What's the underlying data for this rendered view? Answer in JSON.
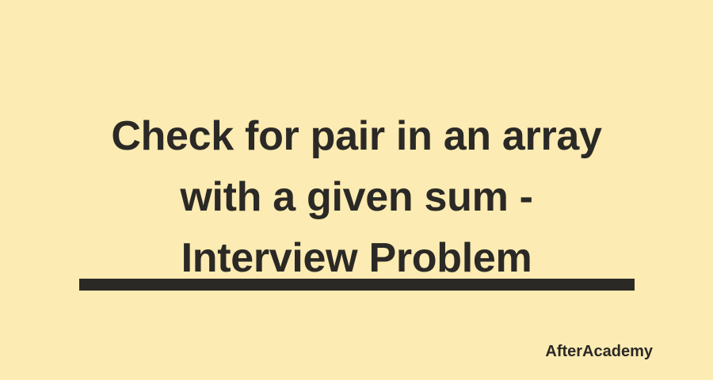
{
  "title": {
    "lines": [
      "Check for pair in an array",
      "with a given sum -",
      "Interview Problem"
    ]
  },
  "brand": {
    "name": "AfterAcademy"
  },
  "colors": {
    "background": "#FCEBB2",
    "text": "#2b2926",
    "rule": "#2b2926"
  }
}
